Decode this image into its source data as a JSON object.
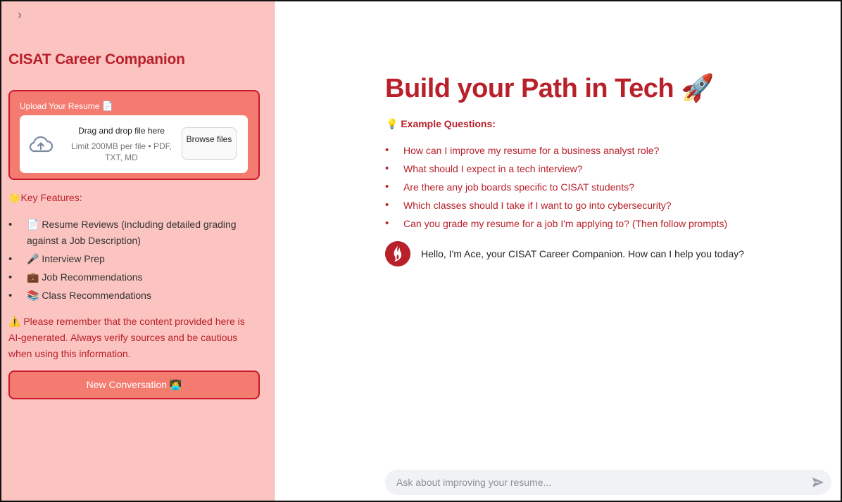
{
  "sidebar": {
    "collapse_glyph": "›",
    "title": "CISAT Career Companion",
    "upload": {
      "label": "Upload Your Resume",
      "label_emoji": "📄",
      "drop_text": "Drag and drop file here",
      "limit_text": "Limit 200MB per file • PDF, TXT, MD",
      "browse_label": "Browse files"
    },
    "key_features": {
      "emoji": "🌟",
      "label": "Key Features:"
    },
    "features": [
      {
        "emoji": "📄",
        "label": "Resume Reviews (including detailed grading against a Job Description)"
      },
      {
        "emoji": "🎤",
        "label": "Interview Prep"
      },
      {
        "emoji": "💼",
        "label": "Job Recommendations"
      },
      {
        "emoji": "📚",
        "label": "Class Recommendations"
      }
    ],
    "warning": {
      "emoji": "⚠️",
      "text": "Please remember that the content provided here is AI-generated. Always verify sources and be cautious when using this information."
    },
    "new_conversation": {
      "label": "New Conversation",
      "emoji": "🧑‍💻"
    }
  },
  "main": {
    "title": "Build your Path in Tech",
    "title_emoji": "🚀",
    "examples": {
      "emoji": "💡",
      "label": "Example Questions:"
    },
    "questions": [
      "How can I improve my resume for a business analyst role?",
      "What should I expect in a tech interview?",
      "Are there any job boards specific to CISAT students?",
      "Which classes should I take if I want to go into cybersecurity?",
      "Can you grade my resume for a job I'm applying to? (Then follow prompts)"
    ],
    "assistant_message": "Hello, I'm Ace, your CISAT Career Companion. How can I help you today?",
    "chat_input": {
      "value": "",
      "placeholder": "Ask about improving your resume..."
    }
  },
  "colors": {
    "sidebar_bg": "#fcc4c1",
    "accent": "#b8202a",
    "button_bg": "#f47b70",
    "input_bg": "#f0f2f6"
  },
  "icons": [
    "chevron-right-icon",
    "cloud-upload-icon",
    "flame-avatar-icon",
    "send-icon"
  ]
}
